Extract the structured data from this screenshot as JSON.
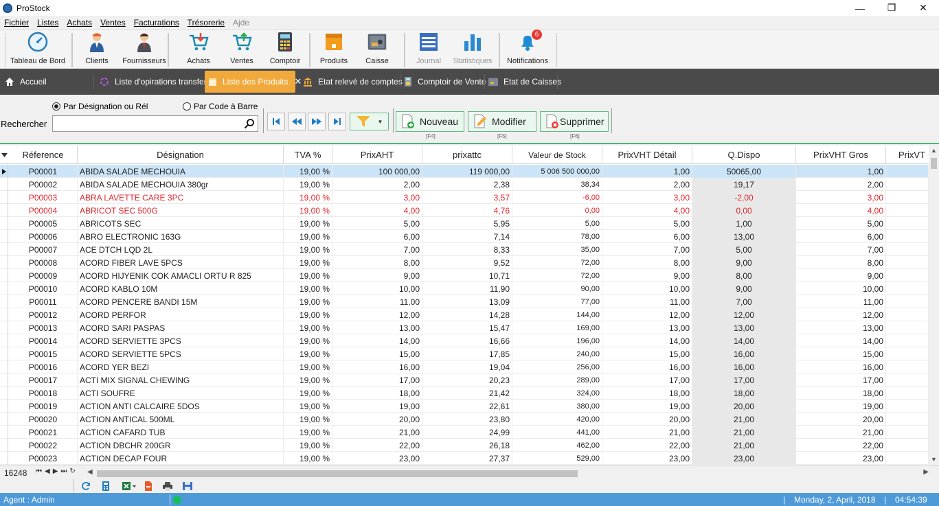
{
  "window": {
    "title": "ProStock",
    "minimize": "—",
    "restore": "❐",
    "close": "✕"
  },
  "menu": [
    {
      "label": "Fichier"
    },
    {
      "label": "Listes"
    },
    {
      "label": "Achats"
    },
    {
      "label": "Ventes"
    },
    {
      "label": "Facturations"
    },
    {
      "label": "Trésorerie"
    },
    {
      "label": "Ajde"
    }
  ],
  "toolbar": {
    "tableau": "Tableau de Bord",
    "clients": "Clients",
    "fournisseurs": "Fournisseurs",
    "achats": "Achats",
    "ventes": "Ventes",
    "comptoir": "Comptoir",
    "produits": "Produits",
    "caisse": "Caisse",
    "journal": "Journal",
    "statistiques": "Statistiques",
    "notifications": "Notifications",
    "notif_count": "6"
  },
  "tabs": {
    "accueil": "Accueil",
    "operations": "Liste d'opirations transfer",
    "produits": "Liste des Produits",
    "releve": "Etat relevé de comptes",
    "comptoir": "Comptoir de Vente",
    "caisses": "Etat de Caisses",
    "close": "✕"
  },
  "search": {
    "radio_designation": "Par Désignation ou Rél",
    "radio_code": "Par Code à Barre",
    "label": "Rechercher",
    "value": ""
  },
  "actions": {
    "nouveau": "Nouveau",
    "nouveau_key": "[F4]",
    "modifier": "Modifier",
    "modifier_key": "[F5]",
    "supprimer": "Supprimer",
    "supprimer_key": "[F6]"
  },
  "grid": {
    "columns": [
      "Réference",
      "Désignation",
      "TVA %",
      "PrixAHT",
      "prixattc",
      "Valeur de Stock",
      "PrixVHT Détail",
      "Q.Dispo",
      "PrixVHT Gros",
      "PrixVT"
    ],
    "rows": [
      {
        "ref": "P00001",
        "des": "ABIDA SALADE MECHOUIA",
        "tva": "19,00 %",
        "aht": "100 000,00",
        "attc": "119 000,00",
        "stock": "5 006 500 000,00",
        "detail": "1,00",
        "qdispo": "50065,00",
        "gros": "1,00",
        "neg": false,
        "selected": true
      },
      {
        "ref": "P00002",
        "des": "ABIDA SALADE MECHOUIA 380gr",
        "tva": "19,00 %",
        "aht": "2,00",
        "attc": "2,38",
        "stock": "38,34",
        "detail": "2,00",
        "qdispo": "19,17",
        "gros": "2,00",
        "neg": false
      },
      {
        "ref": "P00003",
        "des": "ABRA LAVETTE CARE 3PC",
        "tva": "19,00 %",
        "aht": "3,00",
        "attc": "3,57",
        "stock": "-6,00",
        "detail": "3,00",
        "qdispo": "-2,00",
        "gros": "3,00",
        "neg": true
      },
      {
        "ref": "P00004",
        "des": "ABRICOT SEC 500G",
        "tva": "19,00 %",
        "aht": "4,00",
        "attc": "4,76",
        "stock": "0,00",
        "detail": "4,00",
        "qdispo": "0,00",
        "gros": "4,00",
        "neg": true
      },
      {
        "ref": "P00005",
        "des": "ABRICOTS SEC",
        "tva": "19,00 %",
        "aht": "5,00",
        "attc": "5,95",
        "stock": "5,00",
        "detail": "5,00",
        "qdispo": "1,00",
        "gros": "5,00",
        "neg": false
      },
      {
        "ref": "P00006",
        "des": "ABRO ELECTRONIC 163G",
        "tva": "19,00 %",
        "aht": "6,00",
        "attc": "7,14",
        "stock": "78,00",
        "detail": "6,00",
        "qdispo": "13,00",
        "gros": "6,00",
        "neg": false
      },
      {
        "ref": "P00007",
        "des": "ACE DTCH LQD 2L",
        "tva": "19,00 %",
        "aht": "7,00",
        "attc": "8,33",
        "stock": "35,00",
        "detail": "7,00",
        "qdispo": "5,00",
        "gros": "7,00",
        "neg": false
      },
      {
        "ref": "P00008",
        "des": "ACORD FIBER LAVE  5PCS",
        "tva": "19,00 %",
        "aht": "8,00",
        "attc": "9,52",
        "stock": "72,00",
        "detail": "8,00",
        "qdispo": "9,00",
        "gros": "8,00",
        "neg": false
      },
      {
        "ref": "P00009",
        "des": "ACORD HIJYENIK COK AMACLI ORTU R 825",
        "tva": "19,00 %",
        "aht": "9,00",
        "attc": "10,71",
        "stock": "72,00",
        "detail": "9,00",
        "qdispo": "8,00",
        "gros": "9,00",
        "neg": false
      },
      {
        "ref": "P00010",
        "des": "ACORD KABLO 10M",
        "tva": "19,00 %",
        "aht": "10,00",
        "attc": "11,90",
        "stock": "90,00",
        "detail": "10,00",
        "qdispo": "9,00",
        "gros": "10,00",
        "neg": false
      },
      {
        "ref": "P00011",
        "des": "ACORD PENCERE BANDI 15M",
        "tva": "19,00 %",
        "aht": "11,00",
        "attc": "13,09",
        "stock": "77,00",
        "detail": "11,00",
        "qdispo": "7,00",
        "gros": "11,00",
        "neg": false
      },
      {
        "ref": "P00012",
        "des": "ACORD PERFOR",
        "tva": "19,00 %",
        "aht": "12,00",
        "attc": "14,28",
        "stock": "144,00",
        "detail": "12,00",
        "qdispo": "12,00",
        "gros": "12,00",
        "neg": false
      },
      {
        "ref": "P00013",
        "des": "ACORD SARI PASPAS",
        "tva": "19,00 %",
        "aht": "13,00",
        "attc": "15,47",
        "stock": "169,00",
        "detail": "13,00",
        "qdispo": "13,00",
        "gros": "13,00",
        "neg": false
      },
      {
        "ref": "P00014",
        "des": "ACORD SERVIETTE  3PCS",
        "tva": "19,00 %",
        "aht": "14,00",
        "attc": "16,66",
        "stock": "196,00",
        "detail": "14,00",
        "qdispo": "14,00",
        "gros": "14,00",
        "neg": false
      },
      {
        "ref": "P00015",
        "des": "ACORD SERVIETTE  5PCS",
        "tva": "19,00 %",
        "aht": "15,00",
        "attc": "17,85",
        "stock": "240,00",
        "detail": "15,00",
        "qdispo": "16,00",
        "gros": "15,00",
        "neg": false
      },
      {
        "ref": "P00016",
        "des": "ACORD YER BEZI",
        "tva": "19,00 %",
        "aht": "16,00",
        "attc": "19,04",
        "stock": "256,00",
        "detail": "16,00",
        "qdispo": "16,00",
        "gros": "16,00",
        "neg": false
      },
      {
        "ref": "P00017",
        "des": "ACTI MIX SIGNAL CHEWING",
        "tva": "19,00 %",
        "aht": "17,00",
        "attc": "20,23",
        "stock": "289,00",
        "detail": "17,00",
        "qdispo": "17,00",
        "gros": "17,00",
        "neg": false
      },
      {
        "ref": "P00018",
        "des": "ACTI SOUFRE",
        "tva": "19,00 %",
        "aht": "18,00",
        "attc": "21,42",
        "stock": "324,00",
        "detail": "18,00",
        "qdispo": "18,00",
        "gros": "18,00",
        "neg": false
      },
      {
        "ref": "P00019",
        "des": "ACTION ANTI CALCAIRE 5DOS",
        "tva": "19,00 %",
        "aht": "19,00",
        "attc": "22,61",
        "stock": "380,00",
        "detail": "19,00",
        "qdispo": "20,00",
        "gros": "19,00",
        "neg": false
      },
      {
        "ref": "P00020",
        "des": "ACTION ANTICAL 500ML",
        "tva": "19,00 %",
        "aht": "20,00",
        "attc": "23,80",
        "stock": "420,00",
        "detail": "20,00",
        "qdispo": "21,00",
        "gros": "20,00",
        "neg": false
      },
      {
        "ref": "P00021",
        "des": "ACTION CAFARD TUB",
        "tva": "19,00 %",
        "aht": "21,00",
        "attc": "24,99",
        "stock": "441,00",
        "detail": "21,00",
        "qdispo": "21,00",
        "gros": "21,00",
        "neg": false
      },
      {
        "ref": "P00022",
        "des": "ACTION DBCHR 200GR",
        "tva": "19,00 %",
        "aht": "22,00",
        "attc": "26,18",
        "stock": "462,00",
        "detail": "22,00",
        "qdispo": "21,00",
        "gros": "22,00",
        "neg": false
      },
      {
        "ref": "P00023",
        "des": "ACTION DECAP FOUR",
        "tva": "19,00 %",
        "aht": "23,00",
        "attc": "27,37",
        "stock": "529,00",
        "detail": "23,00",
        "qdispo": "23,00",
        "gros": "23,00",
        "neg": false
      }
    ]
  },
  "footer": {
    "record_count": "16248"
  },
  "status": {
    "agent": "Agent : Admin",
    "date": "Monday, 2,  April, 2018",
    "time": "04:54:39",
    "sep": "|"
  },
  "colors": {
    "accent": "#4e9ad8",
    "active_tab": "#f2a93b",
    "tabbar": "#4a4a4a",
    "negative": "#e0282d",
    "selected_row": "#cce4f7",
    "green_border": "#4cb27a"
  }
}
